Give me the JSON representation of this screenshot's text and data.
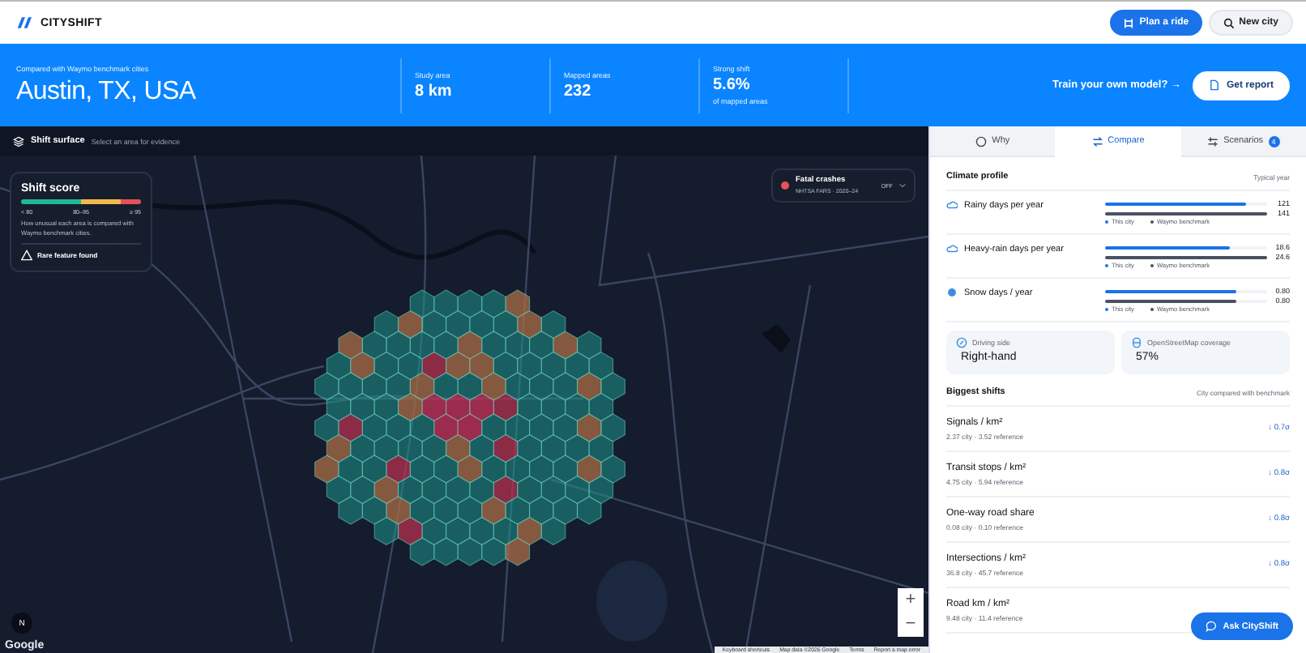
{
  "header": {
    "brand": "CITYSHIFT",
    "buttons": [
      {
        "kind": "primary",
        "label": "Plan a ride"
      },
      {
        "kind": "secondary",
        "label": "New city"
      }
    ]
  },
  "banner": {
    "subtitle": "Compared with Waymo benchmark cities",
    "city": "Austin, TX, USA",
    "stats": [
      {
        "label": "Study area",
        "value": "8 km"
      },
      {
        "label": "Mapped areas",
        "value": "232"
      },
      {
        "label": "Strong shift",
        "value": "5.6%",
        "note": "of mapped areas"
      }
    ],
    "train_link": "Train your own model? →",
    "report_button": "Get report"
  },
  "map": {
    "toolbar": {
      "title": "Shift surface",
      "hint": "Select an area for evidence"
    },
    "legend": {
      "title": "Shift score",
      "ticks": [
        "< 80",
        "80–95",
        "≥ 95"
      ],
      "description": "How unusual each area is compared with Waymo benchmark cities.",
      "flag": "Rare feature found"
    },
    "layer": {
      "title": "Fatal crashes",
      "source": "NHTSA FARS · 2020–24",
      "state": "OFF",
      "color": "#e8505b"
    },
    "zoom": [
      "+",
      "−"
    ],
    "compass": "N",
    "logo": "Google",
    "attribution": [
      "Keyboard shortcuts",
      "Map data ©2026 Google",
      "Terms",
      "Report a map error"
    ]
  },
  "panel": {
    "tabs": [
      {
        "label": "Why",
        "selected": false
      },
      {
        "label": "Compare",
        "selected": true
      },
      {
        "label": "Scenarios",
        "badge": "4",
        "selected": false
      }
    ],
    "climate": {
      "title": "Climate profile",
      "note": "Typical year",
      "rows": [
        {
          "kind": "rain",
          "label": "Rainy days per year",
          "city": {
            "value": "121",
            "level": 0.87
          },
          "benchmark": {
            "value": "141",
            "level": 1.0
          },
          "legend": [
            "This city",
            "Waymo benchmark"
          ]
        },
        {
          "kind": "rain",
          "label": "Heavy-rain days per year",
          "city": {
            "value": "18.6",
            "level": 0.77
          },
          "benchmark": {
            "value": "24.6",
            "level": 1.0
          },
          "legend": [
            "This city",
            "Waymo benchmark"
          ]
        },
        {
          "kind": "snow",
          "label": "Snow days / year",
          "city": {
            "value": "0.80",
            "level": 0.81
          },
          "benchmark": {
            "value": "0.80",
            "level": 0.81
          },
          "legend": [
            "This city",
            "Waymo benchmark"
          ]
        }
      ]
    },
    "facts": [
      {
        "kind": "compass",
        "label": "Driving side",
        "value": "Right-hand"
      },
      {
        "kind": "database",
        "label": "OpenStreetMap coverage",
        "value": "57%"
      }
    ],
    "shifts": {
      "title": "Biggest shifts",
      "note": "City compared with benchmark",
      "rows": [
        {
          "title": "Signals / km²",
          "detail": "2.37 city · 3.52 reference",
          "delta": "↓ 0.7σ"
        },
        {
          "title": "Transit stops / km²",
          "detail": "4.75 city · 5.94 reference",
          "delta": "↓ 0.8σ"
        },
        {
          "title": "One-way road share",
          "detail": "0.08 city · 0.10 reference",
          "delta": "↓ 0.8σ"
        },
        {
          "title": "Intersections / km²",
          "detail": "36.8 city · 45.7 reference",
          "delta": "↓ 0.8σ"
        },
        {
          "title": "Road km / km²",
          "detail": "9.48 city · 11.4 reference"
        }
      ]
    },
    "chat_button": "Ask CityShift"
  }
}
